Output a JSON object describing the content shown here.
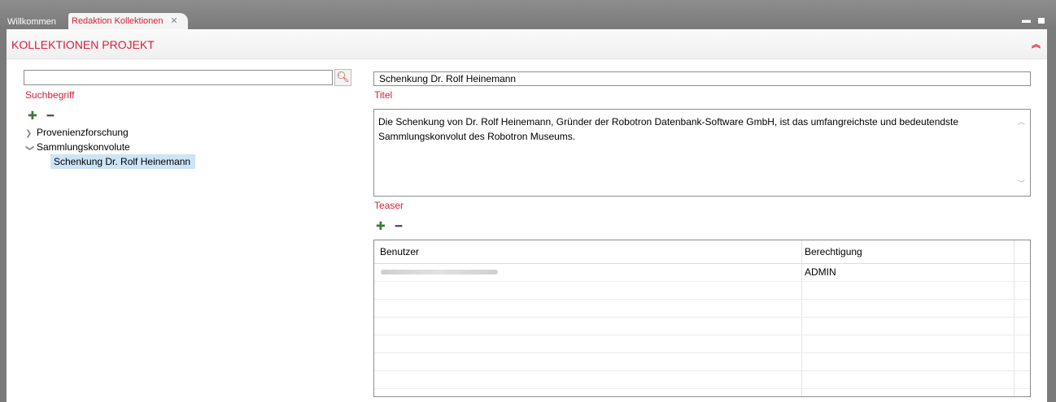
{
  "tabs": [
    {
      "label": "Willkommen",
      "active": false
    },
    {
      "label": "Redaktion Kollektionen",
      "active": true
    }
  ],
  "panel": {
    "title": "KOLLEKTIONEN PROJEKT",
    "collapse_icon": "double-chevron-up-icon"
  },
  "search": {
    "value": "",
    "label": "Suchbegriff"
  },
  "tree": {
    "items": [
      {
        "label": "Provenienzforschung",
        "expanded": false
      },
      {
        "label": "Sammlungskonvolute",
        "expanded": true,
        "children": [
          {
            "label": "Schenkung Dr. Rolf Heinemann",
            "selected": true
          }
        ]
      }
    ]
  },
  "form": {
    "title_value": "Schenkung Dr. Rolf Heinemann",
    "title_label": "Titel",
    "teaser_value": "Die Schenkung von Dr. Rolf Heinemann, Gründer der Robotron Datenbank-Software GmbH, ist das umfangreichste und bedeutendste Sammlungskonvolut des Robotron Museums.",
    "teaser_label": "Teaser"
  },
  "table": {
    "columns": [
      "Benutzer",
      "Berechtigung"
    ],
    "rows": [
      {
        "benutzer": "",
        "berechtigung": "ADMIN"
      }
    ]
  },
  "colors": {
    "accent": "#d6203c",
    "selection": "#cce4f7"
  }
}
